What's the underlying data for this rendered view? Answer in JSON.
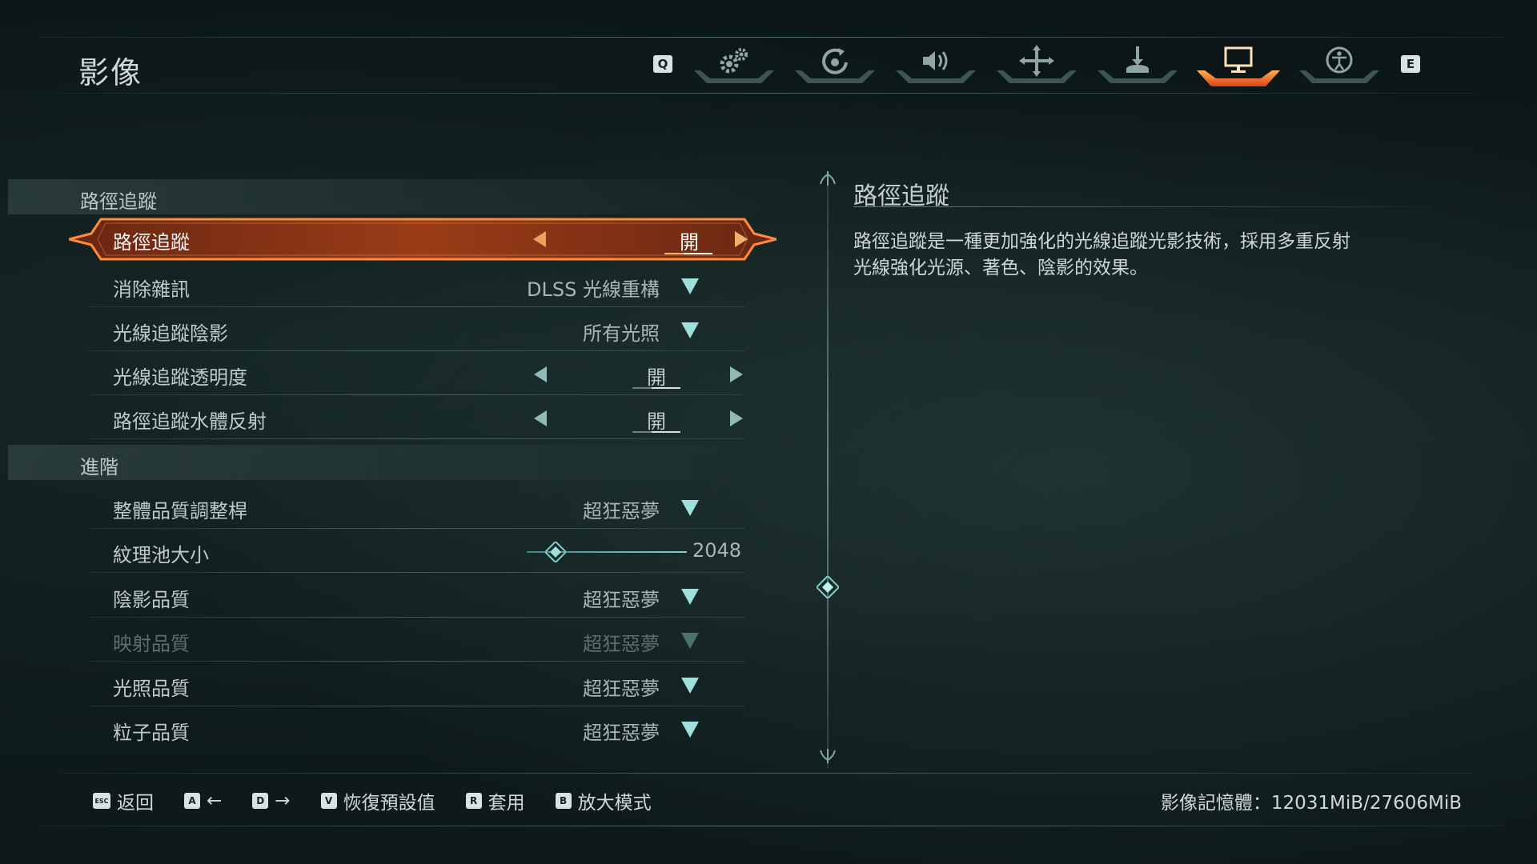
{
  "page_title": "影像",
  "tabs": {
    "prev_key": "Q",
    "next_key": "E",
    "items": [
      {
        "icon": "gear-icon",
        "active": false
      },
      {
        "icon": "controller-icon",
        "active": false
      },
      {
        "icon": "speaker-icon",
        "active": false
      },
      {
        "icon": "move-icon",
        "active": false
      },
      {
        "icon": "joystick-icon",
        "active": false
      },
      {
        "icon": "monitor-icon",
        "active": true
      },
      {
        "icon": "accessibility-icon",
        "active": false
      }
    ]
  },
  "sections": {
    "path_tracing": "路徑追蹤",
    "advanced": "進階"
  },
  "settings": {
    "path_tracing": {
      "label": "路徑追蹤",
      "value": "開"
    },
    "denoise": {
      "label": "消除雜訊",
      "value": "DLSS 光線重構"
    },
    "rt_shadows": {
      "label": "光線追蹤陰影",
      "value": "所有光照"
    },
    "rt_transparency": {
      "label": "光線追蹤透明度",
      "value": "開"
    },
    "pt_water": {
      "label": "路徑追蹤水體反射",
      "value": "開"
    },
    "quality_preset": {
      "label": "整體品質調整桿",
      "value": "超狂惡夢"
    },
    "texture_pool": {
      "label": "紋理池大小",
      "value": "2048",
      "slider_fraction": 0.18
    },
    "shadow_quality": {
      "label": "陰影品質",
      "value": "超狂惡夢"
    },
    "reflection_quality": {
      "label": "映射品質",
      "value": "超狂惡夢",
      "disabled": true
    },
    "lighting_quality": {
      "label": "光照品質",
      "value": "超狂惡夢"
    },
    "particle_quality": {
      "label": "粒子品質",
      "value": "超狂惡夢"
    }
  },
  "description": {
    "title": "路徑追蹤",
    "text": "路徑追蹤是一種更加強化的光線追蹤光影技術，採用多重反射光線強化光源、著色、陰影的效果。"
  },
  "footer": {
    "back": {
      "key": "ESC",
      "label": "返回"
    },
    "left": {
      "key": "A",
      "label": "←"
    },
    "right": {
      "key": "D",
      "label": "→"
    },
    "reset": {
      "key": "V",
      "label": "恢復預設值"
    },
    "apply": {
      "key": "R",
      "label": "套用"
    },
    "zoom": {
      "key": "B",
      "label": "放大模式"
    },
    "vram": "影像記憶體：12031MiB/27606MiB"
  },
  "colors": {
    "accent_active": "#e8642a",
    "teal": "#7ccfc9"
  }
}
